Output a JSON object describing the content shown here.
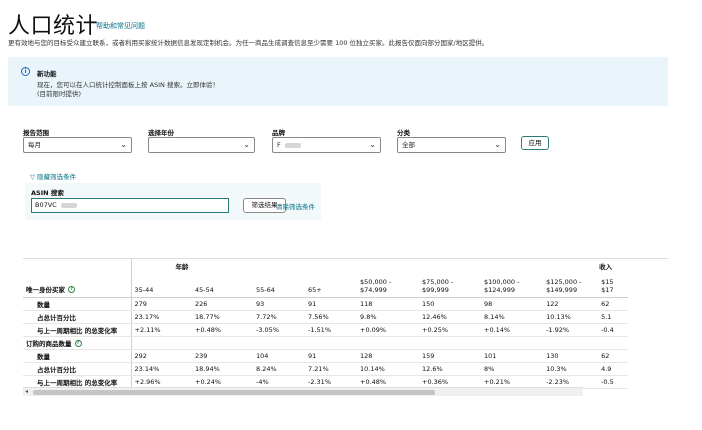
{
  "header": {
    "title": "人口统计",
    "help_link": "帮助和常见问题",
    "description": "更有效地与您的目标受众建立联系，或者利用买家统计数据信息发现定制机会。为任一商品生成调查信息至少需要 100 位独立买家。此报告仅面向部分国家/地区提供。"
  },
  "banner": {
    "title": "新功能",
    "line1": "现在，您可以在人口统计控制面板上按 ASIN 搜索。立即体验！",
    "line2": "(目前限时提供)"
  },
  "filters": {
    "report_range": {
      "label": "报告范围",
      "value": "每月"
    },
    "year": {
      "label": "选择年份",
      "value": ""
    },
    "brand": {
      "label": "品牌",
      "value": "F"
    },
    "category": {
      "label": "分类",
      "value": "全部"
    },
    "apply_label": "应用"
  },
  "asin": {
    "toggle_label": "隐藏筛选条件",
    "search_label": "ASIN 搜索",
    "value": "B07VC",
    "search_button": "筛选结果",
    "clear_link": "清除筛选条件"
  },
  "table": {
    "group_age": "年龄",
    "group_income": "收入",
    "section1": "唯一身份买家",
    "section2": "订购的商品数量",
    "columns": [
      "35-44",
      "45-54",
      "55-64",
      "65+",
      "$50,000 -\n$74,999",
      "$75,000 -\n$99,999",
      "$100,000 -\n$124,999",
      "$125,000 -\n$149,999",
      "$15\n$17"
    ],
    "rows_unique": [
      {
        "label": "数量",
        "values": [
          "279",
          "226",
          "93",
          "91",
          "118",
          "150",
          "98",
          "122",
          "62"
        ]
      },
      {
        "label": "占总计百分比",
        "values": [
          "23.17%",
          "18.77%",
          "7.72%",
          "7.56%",
          "9.8%",
          "12.46%",
          "8.14%",
          "10.13%",
          "5.1"
        ]
      },
      {
        "label": "与上一周期相比 的总变化率",
        "values": [
          "+2.11%",
          "+0.48%",
          "-3.05%",
          "-1.51%",
          "+0.09%",
          "+0.25%",
          "+0.14%",
          "-1.92%",
          "-0.4"
        ]
      }
    ],
    "rows_ordered": [
      {
        "label": "数量",
        "values": [
          "292",
          "239",
          "104",
          "91",
          "128",
          "159",
          "101",
          "130",
          "62"
        ]
      },
      {
        "label": "占总计百分比",
        "values": [
          "23.14%",
          "18.94%",
          "8.24%",
          "7.21%",
          "10.14%",
          "12.6%",
          "8%",
          "10.3%",
          "4.9"
        ]
      },
      {
        "label": "与上一周期相比 的总变化率",
        "values": [
          "+2.96%",
          "+0.24%",
          "-4%",
          "-2.31%",
          "+0.48%",
          "+0.36%",
          "+0.21%",
          "-2.23%",
          "-0.5"
        ]
      }
    ]
  }
}
